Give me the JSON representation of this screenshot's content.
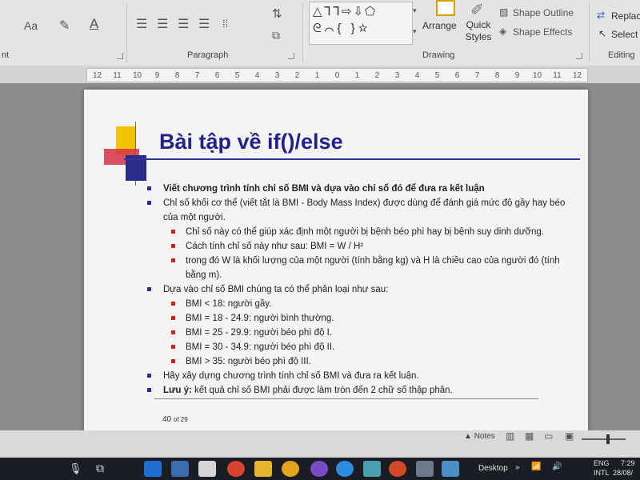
{
  "ribbon": {
    "font_group_label": "nt",
    "font_aa_label": "Aa",
    "paragraph_label": "Paragraph",
    "drawing_label": "Drawing",
    "editing_label": "Editing",
    "arrange_label": "Arrange",
    "quick_styles_label": "Quick Styles",
    "shape_outline_label": "Shape Outline",
    "shape_effects_label": "Shape Effects",
    "replace_label": "Replace",
    "select_label": "Select",
    "shape_glyphs_row1": "△ᒣᒣ⇨⇩⬠",
    "shape_glyphs_row2": "ᘓ⌒{ }☆"
  },
  "ruler": {
    "ticks": [
      "12",
      "11",
      "10",
      "9",
      "8",
      "7",
      "6",
      "5",
      "4",
      "3",
      "2",
      "1",
      "0",
      "1",
      "2",
      "3",
      "4",
      "5",
      "6",
      "7",
      "8",
      "9",
      "10",
      "11",
      "12"
    ]
  },
  "slide": {
    "title": "Bài tập về if()/else",
    "bullets": [
      {
        "level": 1,
        "bold": true,
        "text": "Viết chương trình tính chỉ số BMI và dựa vào chỉ số đó để đưa ra kết luận"
      },
      {
        "level": 1,
        "bold": false,
        "text": "Chỉ số khối cơ thể (viết tắt là BMI - Body Mass Index) được dùng để đánh giá mức độ gầy hay béo của một người."
      },
      {
        "level": 2,
        "bold": false,
        "text": "Chỉ số này có thể giúp xác định một người bị bệnh béo phì hay bị bệnh suy dinh dưỡng."
      },
      {
        "level": 2,
        "bold": false,
        "text": "Cách tính chỉ số này như sau: BMI = W / H²"
      },
      {
        "level": 2,
        "bold": false,
        "text": "trong đó W là khối lượng của một người (tính bằng kg) và H là chiều cao của người đó (tính bằng m)."
      },
      {
        "level": 1,
        "bold": false,
        "text": "Dựa vào chỉ số BMI chúng ta có thể phân loại như sau:"
      },
      {
        "level": 2,
        "bold": false,
        "text": "BMI < 18: người gầy."
      },
      {
        "level": 2,
        "bold": false,
        "text": "BMI = 18 - 24.9: người bình thường."
      },
      {
        "level": 2,
        "bold": false,
        "text": "BMI = 25 - 29.9: người béo phì độ I."
      },
      {
        "level": 2,
        "bold": false,
        "text": "BMI = 30 - 34.9: người béo phì độ II."
      },
      {
        "level": 2,
        "bold": false,
        "text": "BMI > 35: người béo phì độ III."
      },
      {
        "level": 1,
        "bold": false,
        "text": "Hãy xây dựng chương trình tính chỉ số BMI và đưa ra kết luận."
      }
    ],
    "note_label": "Lưu ý:",
    "note_text": " kết quả chỉ số BMI phải được làm tròn đến 2 chữ số thập phân.",
    "page_number": "40",
    "page_of": "of 29"
  },
  "status_bar": {
    "notes_label": "Notes",
    "zoom_level": 0.6
  },
  "taskbar": {
    "desktop_label": "Desktop",
    "lang_top": "ENG",
    "lang_bottom": "INTL",
    "time": "7:29",
    "date": "28/08/"
  },
  "colors": {
    "title": "#222288",
    "level1_bullet": "#2a2c8c",
    "level2_bullet": "#cc2222",
    "accent_yellow": "#f2c400"
  }
}
